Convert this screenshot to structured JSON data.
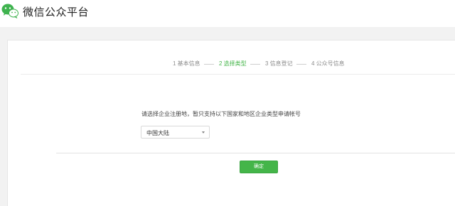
{
  "header": {
    "brand": "微信公众平台",
    "logo_icon": "wechat-logo-icon"
  },
  "steps": [
    {
      "label": "1 基本信息",
      "active": false
    },
    {
      "label": "2 选择类型",
      "active": true
    },
    {
      "label": "3 信息登记",
      "active": false
    },
    {
      "label": "4 公众号信息",
      "active": false
    }
  ],
  "form": {
    "instruction": "请选择企业注册地，暂只支持以下国家和地区企业类型申请帐号",
    "region_select": {
      "value": "中国大陆",
      "caret_icon": "caret-down-icon"
    },
    "confirm_label": "确定"
  },
  "colors": {
    "accent": "#44b549",
    "background": "#f2f2f2"
  }
}
